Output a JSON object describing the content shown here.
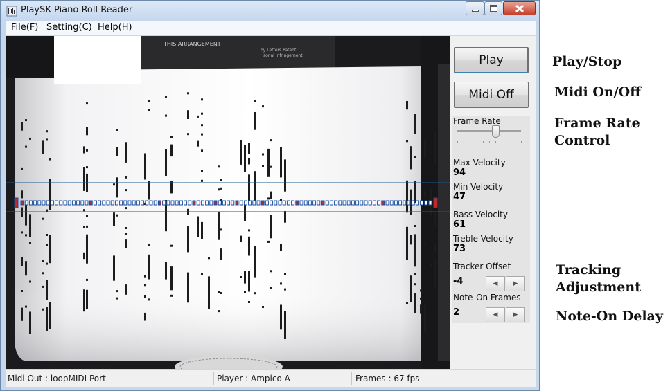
{
  "window": {
    "title": "PlaySK Piano Roll Reader"
  },
  "menu": {
    "file": "File(F)",
    "setting": "Setting(C)",
    "help": "Help(H)"
  },
  "controls": {
    "play": "Play",
    "midi": "Midi Off",
    "frame_rate_label": "Frame Rate",
    "frame_rate_level": 0.6
  },
  "readouts": {
    "max_velocity": {
      "label": "Max Velocity",
      "value": "94"
    },
    "min_velocity": {
      "label": "Min Velocity",
      "value": "47"
    },
    "bass_velocity": {
      "label": "Bass Velocity",
      "value": "61"
    },
    "treble_velocity": {
      "label": "Treble Velocity",
      "value": "73"
    },
    "tracker_offset": {
      "label": "Tracker Offset",
      "value": "-4"
    },
    "note_on_frames": {
      "label": "Note-On Frames",
      "value": "2"
    }
  },
  "status": {
    "midi_out": "Midi Out : loopMIDI Port",
    "player": "Player : Ampico A",
    "frames": "Frames : 67 fps"
  },
  "annotations": {
    "play_stop": "Play/Stop",
    "midi_on_off": "Midi On/Off",
    "frame_rate_1": "Frame Rate",
    "frame_rate_2": "Control",
    "tracking_1": "Tracking",
    "tracking_2": "Adjustment",
    "note_on_delay": "Note-On Delay"
  },
  "roll_header_text": [
    "THIS ARRANGEMENT",
    "by Letters Patent",
    "sonal infringement"
  ],
  "icons": {
    "app": "piano-roll-icon",
    "minimize": "minimize-icon",
    "maximize": "maximize-icon",
    "close": "close-icon",
    "spin_left": "arrow-left-icon",
    "spin_right": "arrow-right-icon"
  },
  "colors": {
    "title_bg": "#c4d6ee",
    "close_red": "#c6402b",
    "tracker_line": "#1a4fa0",
    "hole_active": "#c0282c"
  }
}
